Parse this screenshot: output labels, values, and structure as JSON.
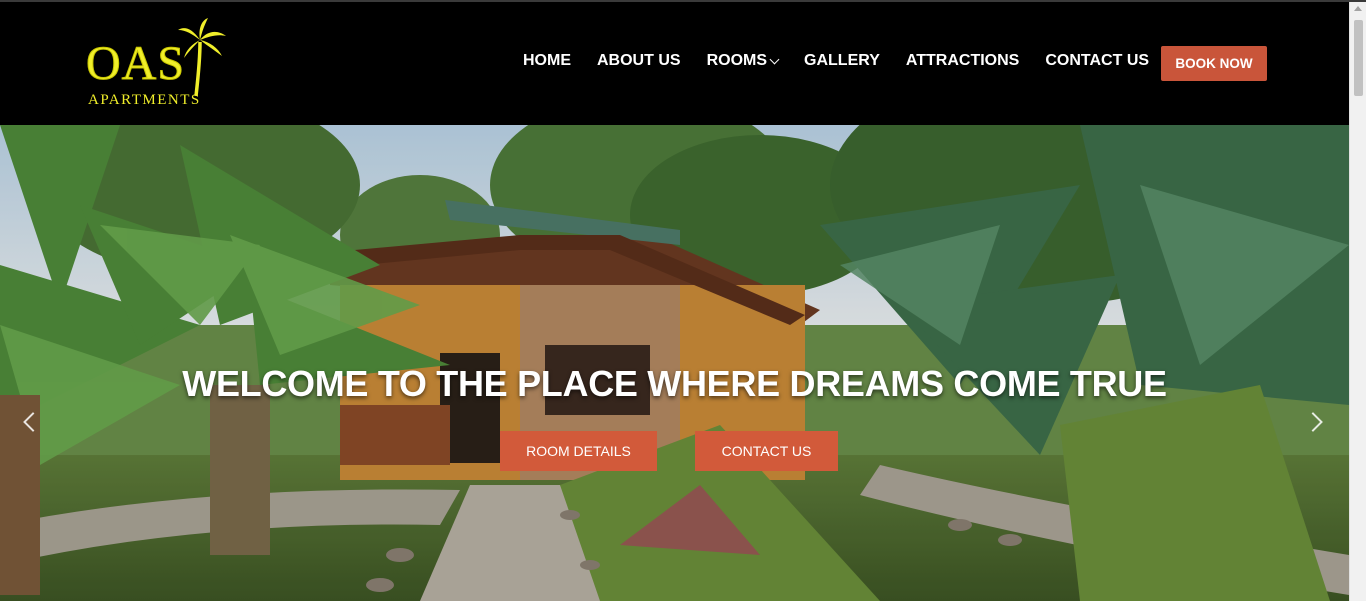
{
  "brand": {
    "logo_word": "OAS",
    "logo_sub": "APARTMENTS"
  },
  "nav": {
    "items": [
      {
        "label": "HOME"
      },
      {
        "label": "ABOUT US"
      },
      {
        "label": "ROOMS",
        "has_dropdown": true
      },
      {
        "label": "GALLERY"
      },
      {
        "label": "ATTRACTIONS"
      },
      {
        "label": "CONTACT US"
      }
    ],
    "book_label": "BOOK NOW"
  },
  "hero": {
    "title": "WELCOME TO THE PLACE WHERE DREAMS COME TRUE",
    "room_button": "ROOM DETAILS",
    "contact_button": "CONTACT US"
  },
  "colors": {
    "accent": "#d25a3a",
    "logo": "#f0ee2a",
    "header_bg": "#000000"
  },
  "icons": [
    "palm-tree-icon",
    "chevron-down-icon",
    "chevron-left-icon",
    "chevron-right-icon"
  ]
}
